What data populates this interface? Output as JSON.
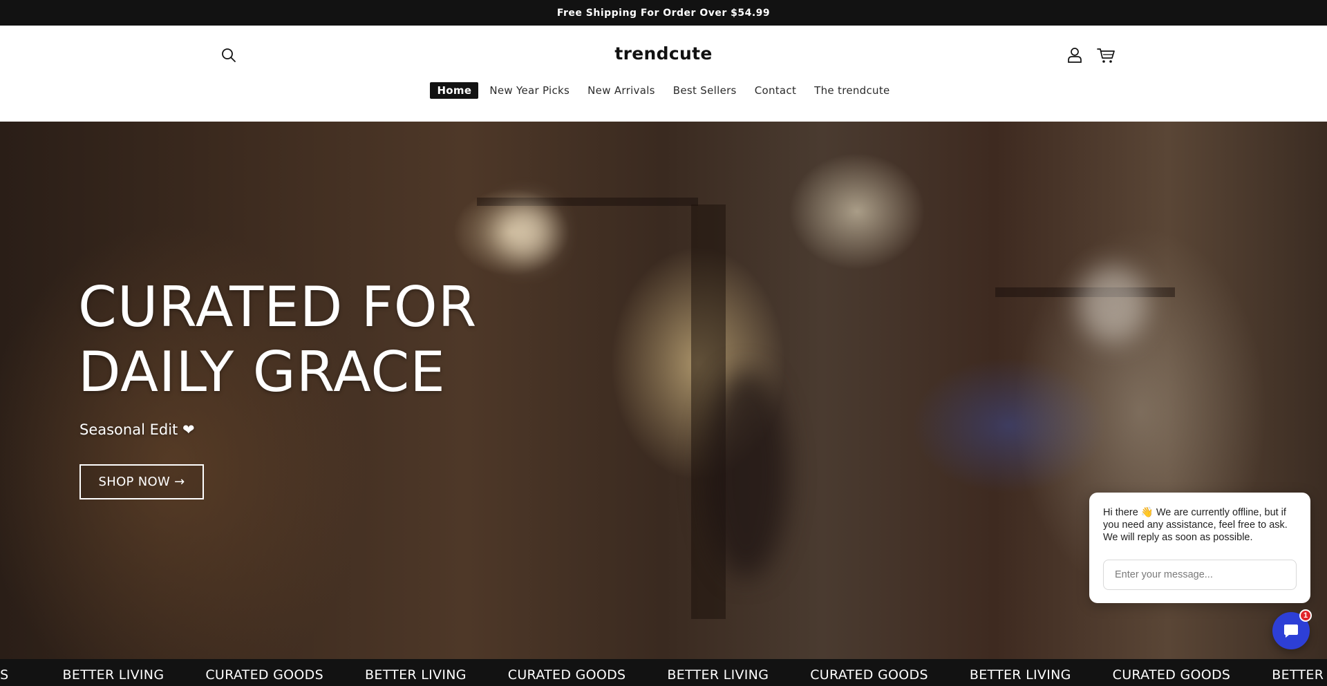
{
  "announcement": {
    "text": "Free Shipping For Order Over $54.99"
  },
  "header": {
    "logo": "trendcute",
    "icons": {
      "search": "search-icon",
      "account": "user-icon",
      "cart": "cart-icon"
    }
  },
  "nav": {
    "items": [
      {
        "label": "Home",
        "active": true
      },
      {
        "label": "New Year Picks",
        "active": false
      },
      {
        "label": "New Arrivals",
        "active": false
      },
      {
        "label": "Best Sellers",
        "active": false
      },
      {
        "label": "Contact",
        "active": false
      },
      {
        "label": "The trendcute",
        "active": false
      }
    ]
  },
  "hero": {
    "title_line1": "CURATED FOR",
    "title_line2": "DAILY GRACE",
    "subtitle": "Seasonal Edit ❤",
    "cta": "SHOP NOW →"
  },
  "marquee": {
    "words": [
      "ODS",
      "BETTER LIVING",
      "CURATED GOODS",
      "BETTER LIVING",
      "CURATED GOODS",
      "BETTER LIVING",
      "CURATED GOODS",
      "BETTER LIVING",
      "CURATED GOODS",
      "BETTER LI"
    ]
  },
  "chat": {
    "message": "Hi there 👋 We are currently offline, but if you need any assistance, feel free to ask. We will reply as soon as possible.",
    "input_placeholder": "Enter your message...",
    "badge_count": "1",
    "launcher_icon": "chat-bubble-icon"
  },
  "colors": {
    "announcement_bg": "#121212",
    "nav_active_bg": "#121212",
    "chat_launcher": "#2d3fd6",
    "chat_badge": "#e0242b"
  }
}
